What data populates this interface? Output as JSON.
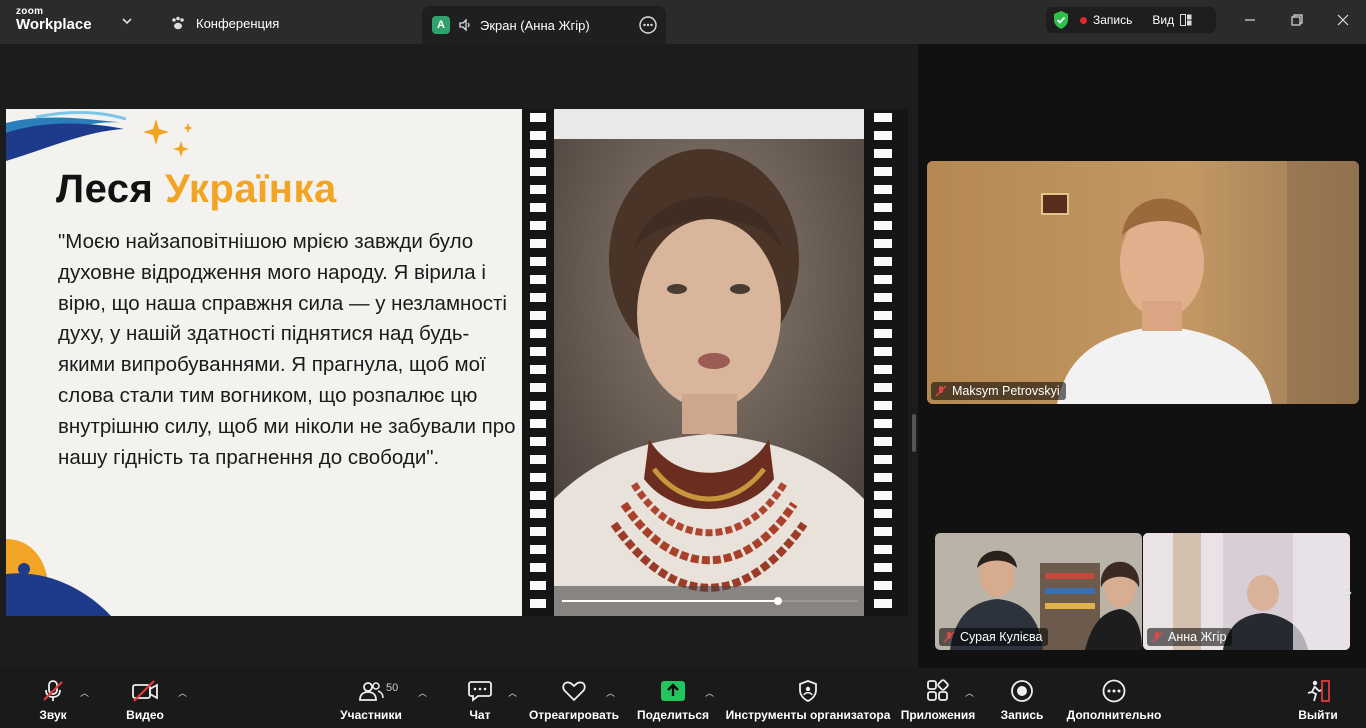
{
  "app": {
    "logo_small": "zoom",
    "logo_big": "Workplace"
  },
  "header": {
    "conference_label": "Конференция",
    "tab_avatar_letter": "A",
    "tab_title": "Экран (Анна Жгір)",
    "record_label": "Запись",
    "view_label": "Вид"
  },
  "slide": {
    "title_part1": "Леся",
    "title_part2": "Українка",
    "quote": "\"Моєю найзаповітнішою мрією завжди було духовне відродження мого народу. Я вірила і вірю, що наша справжня сила — у незламності духу, у нашій здатності піднятися над будь-якими випробуваннями. Я прагнула, щоб мої слова стали тим вогником, що розпалює цю внутрішню силу, щоб ми ніколи не забували про нашу гідність та прагнення до свободи\".",
    "video_progress": 0.73
  },
  "participants": {
    "main": {
      "name": "Maksym Petrovskyi"
    },
    "small": [
      {
        "name": "Сурая Кулієва"
      },
      {
        "name": "Анна Жгір"
      }
    ]
  },
  "toolbar": {
    "audio": "Звук",
    "video": "Видео",
    "participants": "Участники",
    "participants_count": "50",
    "chat": "Чат",
    "react": "Отреагировать",
    "share": "Поделиться",
    "host_tools": "Инструменты организатора",
    "apps": "Приложения",
    "record": "Запись",
    "more": "Дополнительно",
    "leave": "Выйти"
  },
  "colors": {
    "accent_orange": "#f2a524",
    "share_green": "#22c55e",
    "security_green": "#2fbf4b",
    "record_red": "#e02828",
    "leave_red": "#e03b3b"
  }
}
